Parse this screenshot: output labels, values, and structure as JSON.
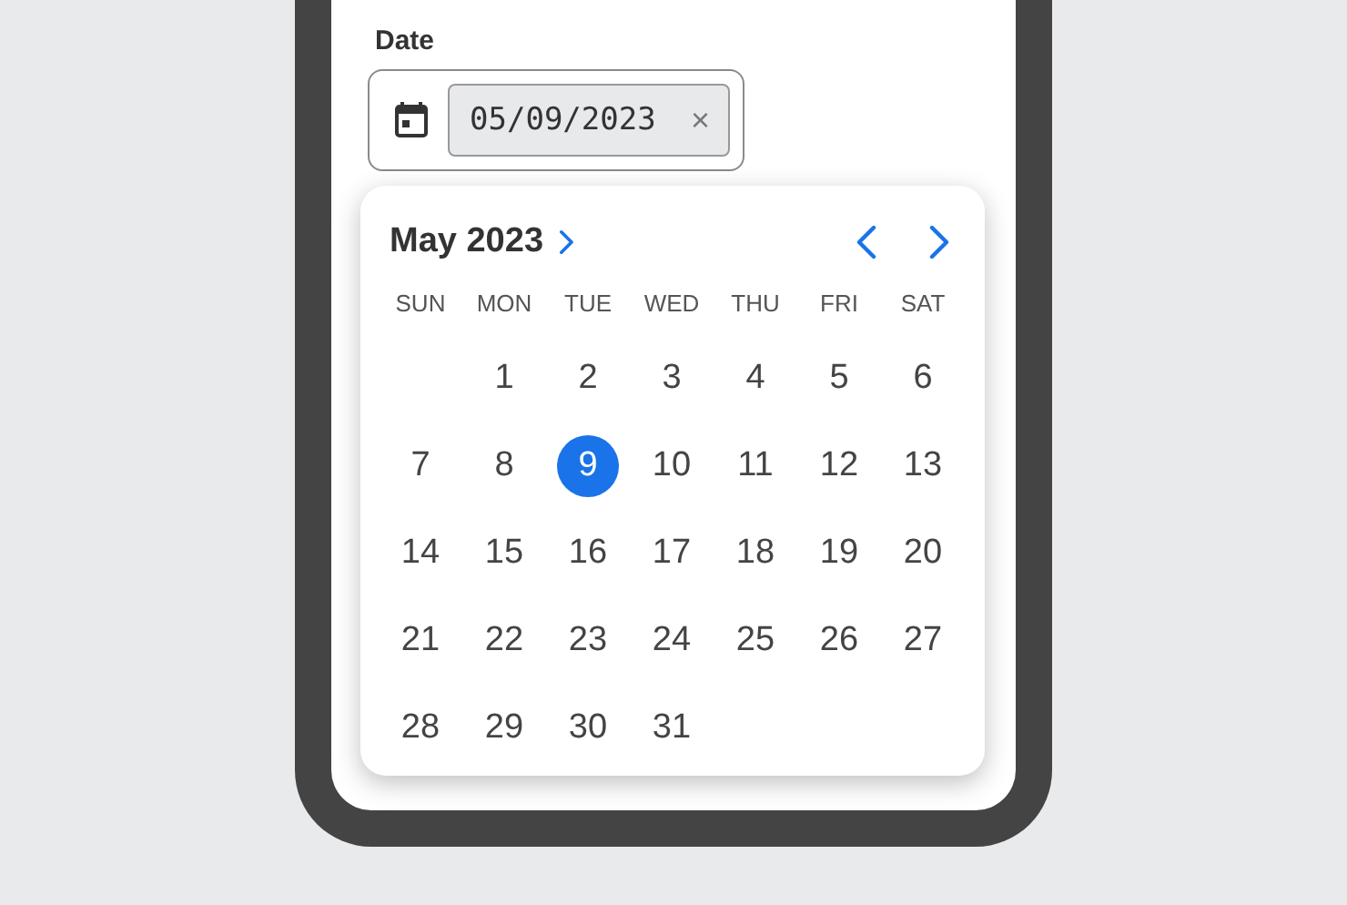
{
  "field": {
    "label": "Date",
    "value": "05/09/2023",
    "clear": "×"
  },
  "calendar": {
    "month_title": "May 2023",
    "weekdays": [
      "SUN",
      "MON",
      "TUE",
      "WED",
      "THU",
      "FRI",
      "SAT"
    ],
    "weeks": [
      [
        {
          "kind": "blank"
        },
        {
          "kind": "day",
          "label": "1",
          "selected": false
        },
        {
          "kind": "day",
          "label": "2",
          "selected": false
        },
        {
          "kind": "day",
          "label": "3",
          "selected": false
        },
        {
          "kind": "day",
          "label": "4",
          "selected": false
        },
        {
          "kind": "day",
          "label": "5",
          "selected": false
        },
        {
          "kind": "day",
          "label": "6",
          "selected": false
        }
      ],
      [
        {
          "kind": "day",
          "label": "7",
          "selected": false
        },
        {
          "kind": "day",
          "label": "8",
          "selected": false
        },
        {
          "kind": "day",
          "label": "9",
          "selected": true
        },
        {
          "kind": "day",
          "label": "10",
          "selected": false
        },
        {
          "kind": "day",
          "label": "11",
          "selected": false
        },
        {
          "kind": "day",
          "label": "12",
          "selected": false
        },
        {
          "kind": "day",
          "label": "13",
          "selected": false
        }
      ],
      [
        {
          "kind": "day",
          "label": "14",
          "selected": false
        },
        {
          "kind": "day",
          "label": "15",
          "selected": false
        },
        {
          "kind": "day",
          "label": "16",
          "selected": false
        },
        {
          "kind": "day",
          "label": "17",
          "selected": false
        },
        {
          "kind": "day",
          "label": "18",
          "selected": false
        },
        {
          "kind": "day",
          "label": "19",
          "selected": false
        },
        {
          "kind": "day",
          "label": "20",
          "selected": false
        }
      ],
      [
        {
          "kind": "day",
          "label": "21",
          "selected": false
        },
        {
          "kind": "day",
          "label": "22",
          "selected": false
        },
        {
          "kind": "day",
          "label": "23",
          "selected": false
        },
        {
          "kind": "day",
          "label": "24",
          "selected": false
        },
        {
          "kind": "day",
          "label": "25",
          "selected": false
        },
        {
          "kind": "day",
          "label": "26",
          "selected": false
        },
        {
          "kind": "day",
          "label": "27",
          "selected": false
        }
      ],
      [
        {
          "kind": "day",
          "label": "28",
          "selected": false
        },
        {
          "kind": "day",
          "label": "29",
          "selected": false
        },
        {
          "kind": "day",
          "label": "30",
          "selected": false
        },
        {
          "kind": "day",
          "label": "31",
          "selected": false
        }
      ]
    ]
  }
}
